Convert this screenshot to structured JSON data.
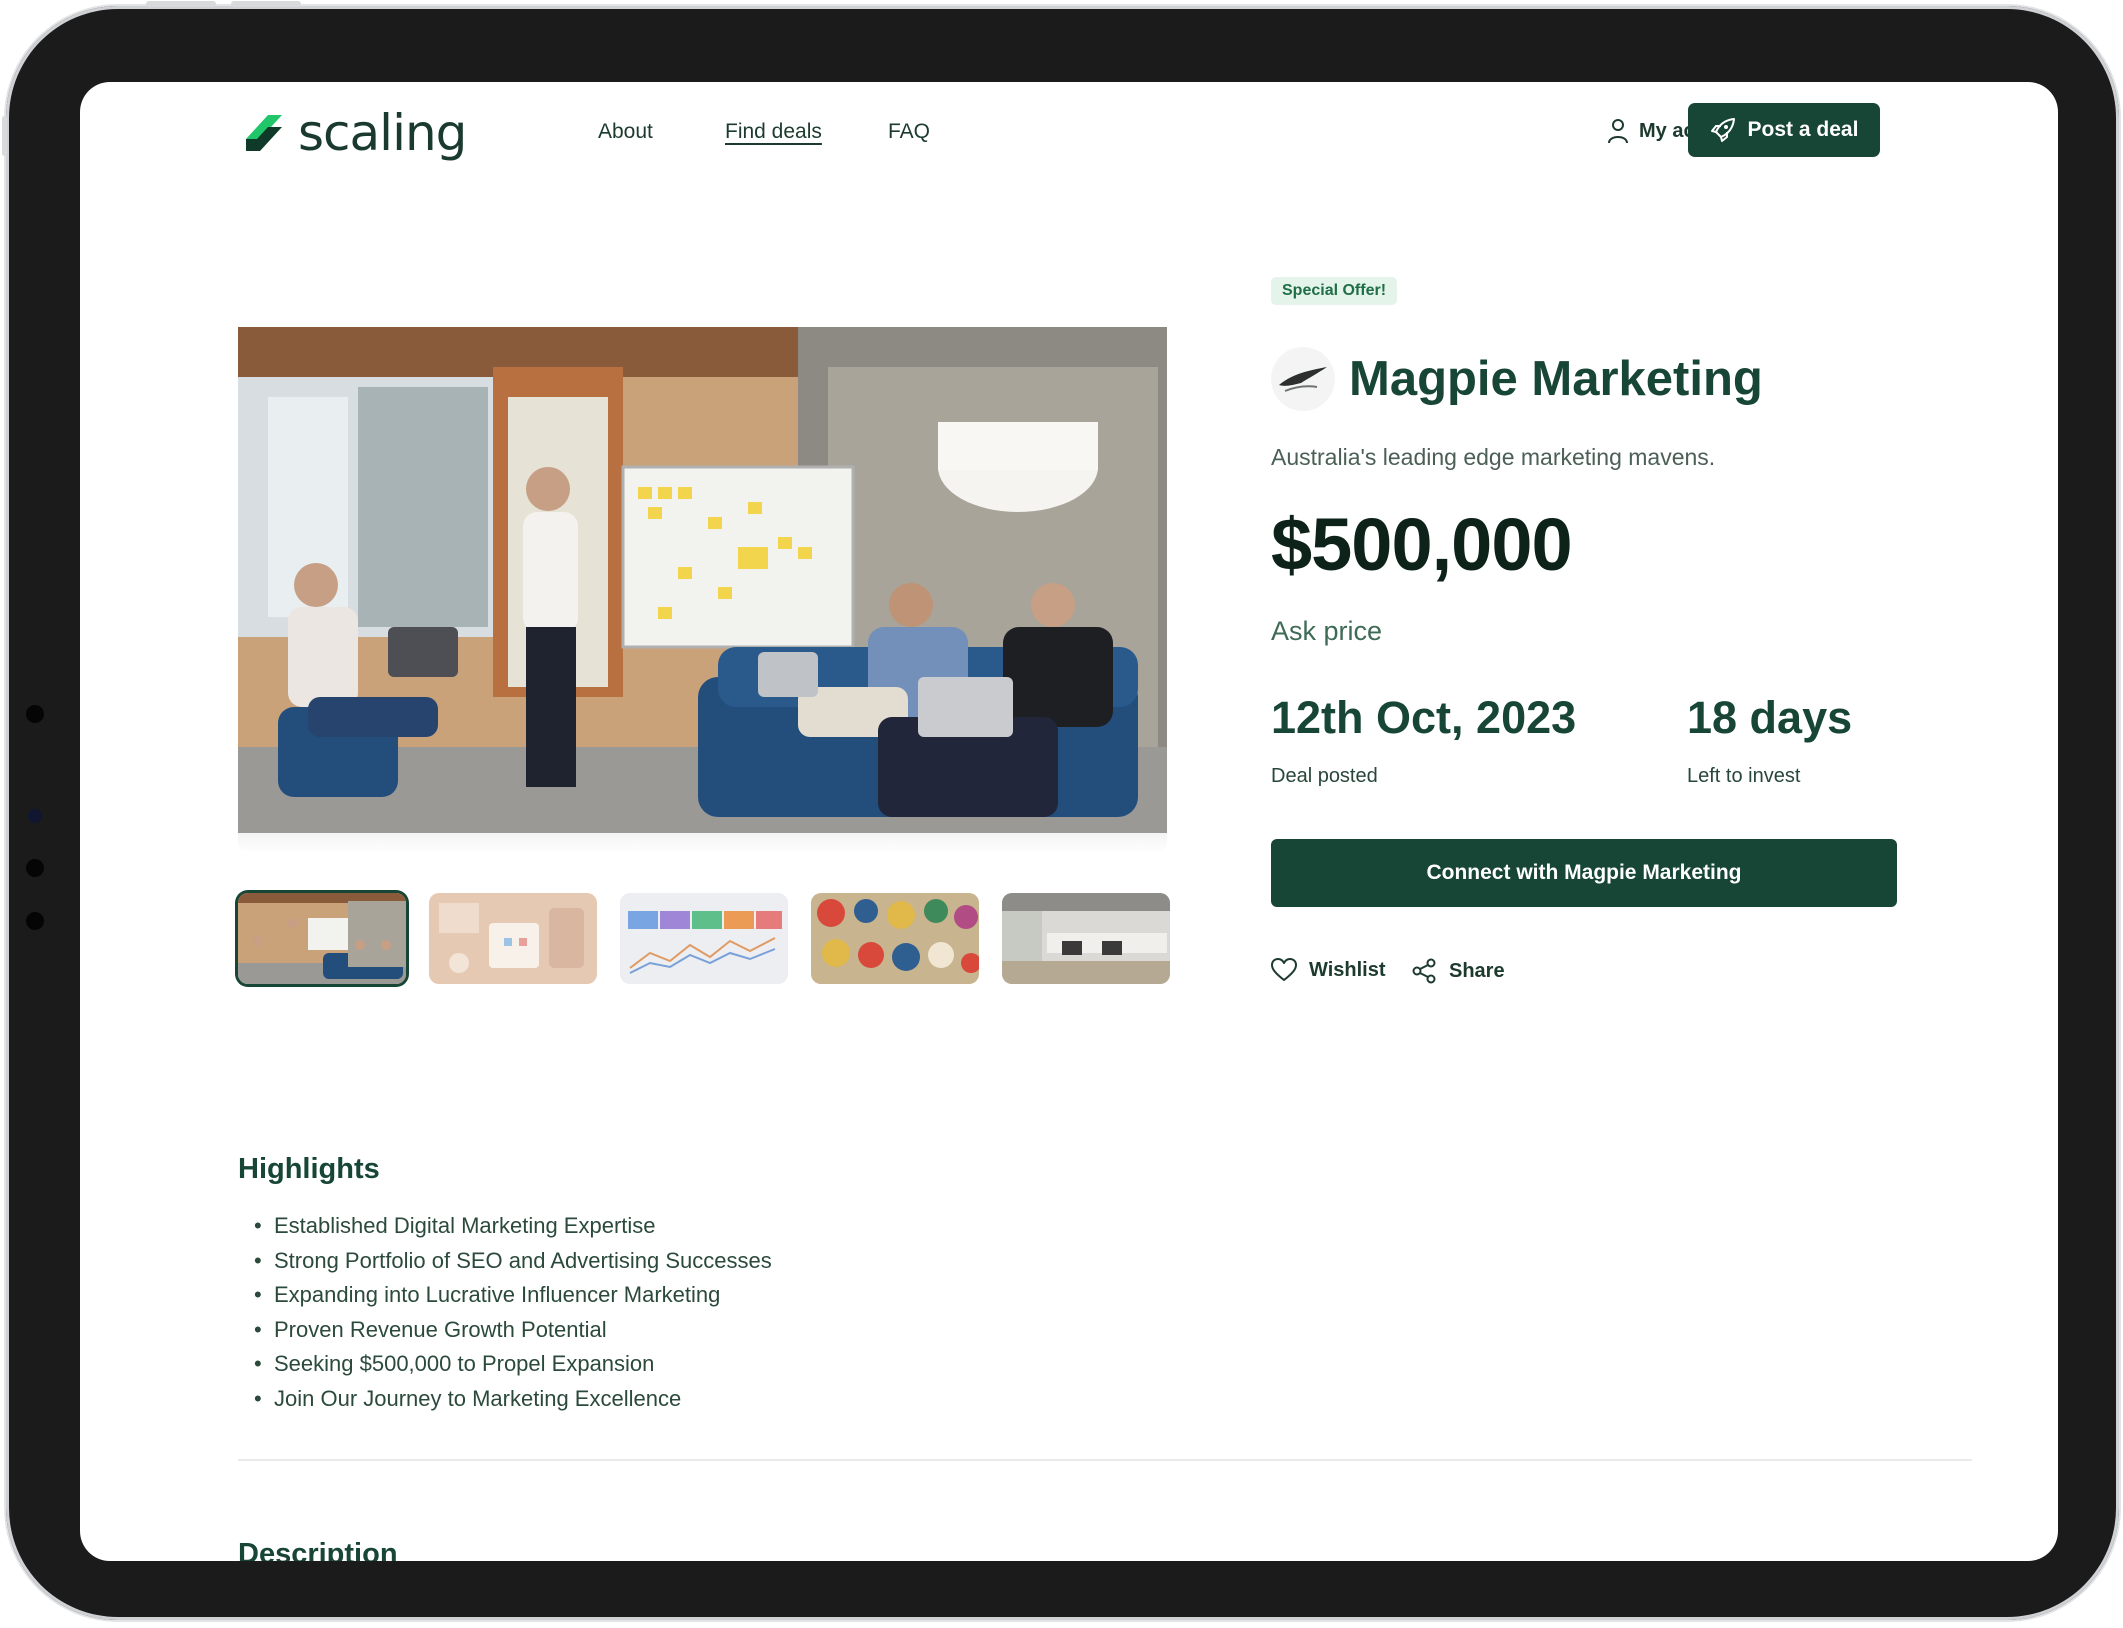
{
  "nav": {
    "logo_text": "scaling",
    "links": [
      {
        "label": "About",
        "active": false
      },
      {
        "label": "Find deals",
        "active": true
      },
      {
        "label": "FAQ",
        "active": false
      }
    ],
    "account_label": "My account",
    "post_label": "Post a deal"
  },
  "deal": {
    "badge": "Special Offer!",
    "name": "Magpie Marketing",
    "tagline": "Australia's leading edge marketing mavens.",
    "price": "$500,000",
    "price_label": "Ask price",
    "posted_value": "12th Oct, 2023",
    "posted_label": "Deal posted",
    "left_value": "18 days",
    "left_label": "Left to invest",
    "connect_label": "Connect with Magpie Marketing",
    "wishlist_label": "Wishlist",
    "share_label": "Share"
  },
  "gallery": {
    "selected_index": 0,
    "thumbnails": [
      "office-team-meeting",
      "desk-flatlay",
      "analytics-dashboard",
      "sticker-collage",
      "open-office"
    ]
  },
  "highlights": {
    "title": "Highlights",
    "items": [
      "Established Digital Marketing Expertise",
      "Strong Portfolio of SEO and Advertising Successes",
      "Expanding into Lucrative Influencer Marketing",
      "Proven Revenue Growth Potential",
      "Seeking $500,000 to Propel Expansion",
      "Join Our Journey to Marketing Excellence"
    ]
  },
  "description": {
    "title": "Description"
  },
  "colors": {
    "brand_green": "#174536",
    "badge_bg": "#e4f4ea",
    "badge_text": "#1f6e45",
    "logo_light_green": "#21c66b"
  }
}
